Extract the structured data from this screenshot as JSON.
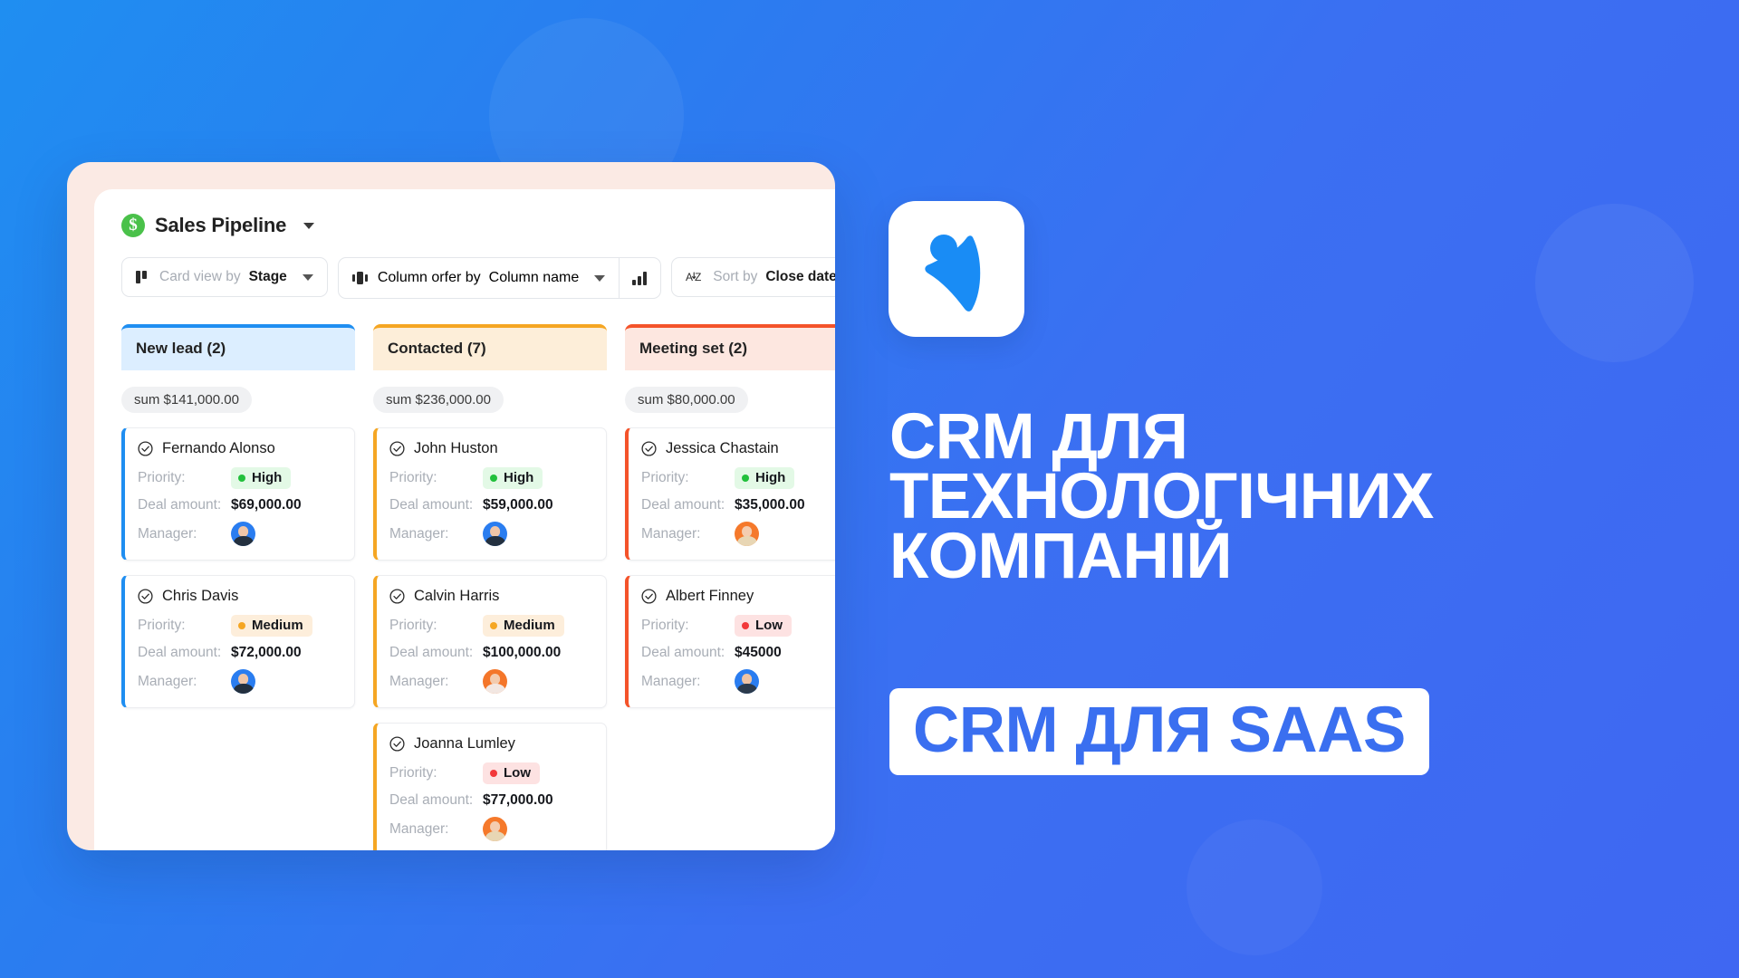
{
  "app": {
    "pipeline_title": "Sales Pipeline",
    "coin_icon": "dollar-coin-icon",
    "title_caret": "chevron-down-icon"
  },
  "toolbar": {
    "card_view": {
      "icon": "kanban-icon",
      "label": "Card view by",
      "value": "Stage",
      "caret": "chevron-down-icon"
    },
    "column_order": {
      "icon": "columns-icon",
      "label": "Column orfer by",
      "value": "Column name",
      "caret": "chevron-down-icon"
    },
    "chart_button": {
      "icon": "bar-chart-icon"
    },
    "sort": {
      "icon": "sort-az-icon",
      "label": "Sort by",
      "value": "Close date"
    }
  },
  "board": {
    "columns": [
      {
        "title": "New lead (2)",
        "accent": "#1f8ef1",
        "header_bg": "#dceeff",
        "sum": "sum $141,000.00",
        "labels": {
          "priority": "Priority:",
          "deal": "Deal amount:",
          "manager": "Manager:"
        },
        "cards": [
          {
            "name": "Fernando Alonso",
            "priority": "High",
            "priority_level": "high",
            "deal": "$69,000.00",
            "avatar": "female-dark-hair-avatar"
          },
          {
            "name": "Chris Davis",
            "priority": "Medium",
            "priority_level": "medium",
            "deal": "$72,000.00",
            "avatar": "female-dark-hair-avatar"
          }
        ]
      },
      {
        "title": "Contacted (7)",
        "accent": "#f5a623",
        "header_bg": "#fdeed9",
        "sum": "sum $236,000.00",
        "labels": {
          "priority": "Priority:",
          "deal": "Deal amount:",
          "manager": "Manager:"
        },
        "cards": [
          {
            "name": "John Huston",
            "priority": "High",
            "priority_level": "high",
            "deal": "$59,000.00",
            "avatar": "female-dark-hair-avatar"
          },
          {
            "name": "Calvin Harris",
            "priority": "Medium",
            "priority_level": "medium",
            "deal": "$100,000.00",
            "avatar": "female-red-hair-avatar"
          },
          {
            "name": "Joanna Lumley",
            "priority": "Low",
            "priority_level": "low",
            "deal": "$77,000.00",
            "avatar": "female-blonde-avatar"
          }
        ]
      },
      {
        "title": "Meeting set (2)",
        "accent": "#f4532a",
        "header_bg": "#fde7e0",
        "sum": "sum $80,000.00",
        "labels": {
          "priority": "Priority:",
          "deal": "Deal amount:",
          "manager": "Manager:"
        },
        "cards": [
          {
            "name": "Jessica Chastain",
            "priority": "High",
            "priority_level": "high",
            "deal": "$35,000.00",
            "avatar": "female-blonde-avatar"
          },
          {
            "name": "Albert Finney",
            "priority": "Low",
            "priority_level": "low",
            "deal": "$45000",
            "avatar": "male-glasses-avatar"
          }
        ]
      }
    ]
  },
  "marketing": {
    "logo_icon": "bitrix-person-logo-icon",
    "headline_lines": [
      "CRM ДЛЯ",
      "ТЕХНОЛОГІЧНИХ",
      "КОМПАНІЙ"
    ],
    "subline": "CRM ДЛЯ SAAS",
    "colors": {
      "background_start": "#1f8ef1",
      "background_end": "#3f67f2",
      "accent_blue": "#3a6ff0",
      "white": "#ffffff"
    }
  }
}
